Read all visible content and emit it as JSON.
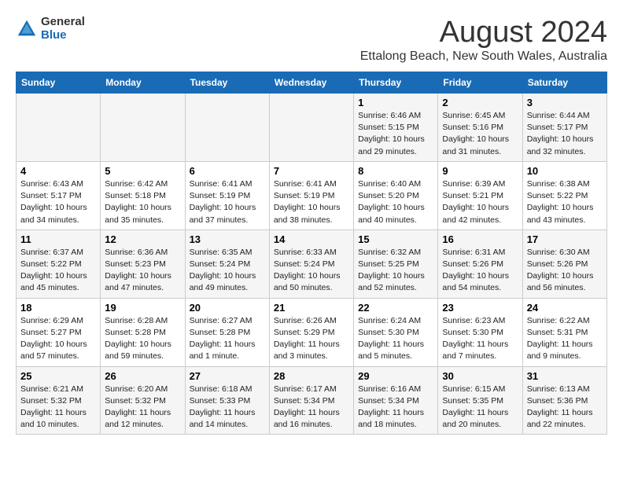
{
  "header": {
    "logo_general": "General",
    "logo_blue": "Blue",
    "month_title": "August 2024",
    "location": "Ettalong Beach, New South Wales, Australia"
  },
  "days_of_week": [
    "Sunday",
    "Monday",
    "Tuesday",
    "Wednesday",
    "Thursday",
    "Friday",
    "Saturday"
  ],
  "weeks": [
    [
      {
        "day": "",
        "info": ""
      },
      {
        "day": "",
        "info": ""
      },
      {
        "day": "",
        "info": ""
      },
      {
        "day": "",
        "info": ""
      },
      {
        "day": "1",
        "info": "Sunrise: 6:46 AM\nSunset: 5:15 PM\nDaylight: 10 hours\nand 29 minutes."
      },
      {
        "day": "2",
        "info": "Sunrise: 6:45 AM\nSunset: 5:16 PM\nDaylight: 10 hours\nand 31 minutes."
      },
      {
        "day": "3",
        "info": "Sunrise: 6:44 AM\nSunset: 5:17 PM\nDaylight: 10 hours\nand 32 minutes."
      }
    ],
    [
      {
        "day": "4",
        "info": "Sunrise: 6:43 AM\nSunset: 5:17 PM\nDaylight: 10 hours\nand 34 minutes."
      },
      {
        "day": "5",
        "info": "Sunrise: 6:42 AM\nSunset: 5:18 PM\nDaylight: 10 hours\nand 35 minutes."
      },
      {
        "day": "6",
        "info": "Sunrise: 6:41 AM\nSunset: 5:19 PM\nDaylight: 10 hours\nand 37 minutes."
      },
      {
        "day": "7",
        "info": "Sunrise: 6:41 AM\nSunset: 5:19 PM\nDaylight: 10 hours\nand 38 minutes."
      },
      {
        "day": "8",
        "info": "Sunrise: 6:40 AM\nSunset: 5:20 PM\nDaylight: 10 hours\nand 40 minutes."
      },
      {
        "day": "9",
        "info": "Sunrise: 6:39 AM\nSunset: 5:21 PM\nDaylight: 10 hours\nand 42 minutes."
      },
      {
        "day": "10",
        "info": "Sunrise: 6:38 AM\nSunset: 5:22 PM\nDaylight: 10 hours\nand 43 minutes."
      }
    ],
    [
      {
        "day": "11",
        "info": "Sunrise: 6:37 AM\nSunset: 5:22 PM\nDaylight: 10 hours\nand 45 minutes."
      },
      {
        "day": "12",
        "info": "Sunrise: 6:36 AM\nSunset: 5:23 PM\nDaylight: 10 hours\nand 47 minutes."
      },
      {
        "day": "13",
        "info": "Sunrise: 6:35 AM\nSunset: 5:24 PM\nDaylight: 10 hours\nand 49 minutes."
      },
      {
        "day": "14",
        "info": "Sunrise: 6:33 AM\nSunset: 5:24 PM\nDaylight: 10 hours\nand 50 minutes."
      },
      {
        "day": "15",
        "info": "Sunrise: 6:32 AM\nSunset: 5:25 PM\nDaylight: 10 hours\nand 52 minutes."
      },
      {
        "day": "16",
        "info": "Sunrise: 6:31 AM\nSunset: 5:26 PM\nDaylight: 10 hours\nand 54 minutes."
      },
      {
        "day": "17",
        "info": "Sunrise: 6:30 AM\nSunset: 5:26 PM\nDaylight: 10 hours\nand 56 minutes."
      }
    ],
    [
      {
        "day": "18",
        "info": "Sunrise: 6:29 AM\nSunset: 5:27 PM\nDaylight: 10 hours\nand 57 minutes."
      },
      {
        "day": "19",
        "info": "Sunrise: 6:28 AM\nSunset: 5:28 PM\nDaylight: 10 hours\nand 59 minutes."
      },
      {
        "day": "20",
        "info": "Sunrise: 6:27 AM\nSunset: 5:28 PM\nDaylight: 11 hours\nand 1 minute."
      },
      {
        "day": "21",
        "info": "Sunrise: 6:26 AM\nSunset: 5:29 PM\nDaylight: 11 hours\nand 3 minutes."
      },
      {
        "day": "22",
        "info": "Sunrise: 6:24 AM\nSunset: 5:30 PM\nDaylight: 11 hours\nand 5 minutes."
      },
      {
        "day": "23",
        "info": "Sunrise: 6:23 AM\nSunset: 5:30 PM\nDaylight: 11 hours\nand 7 minutes."
      },
      {
        "day": "24",
        "info": "Sunrise: 6:22 AM\nSunset: 5:31 PM\nDaylight: 11 hours\nand 9 minutes."
      }
    ],
    [
      {
        "day": "25",
        "info": "Sunrise: 6:21 AM\nSunset: 5:32 PM\nDaylight: 11 hours\nand 10 minutes."
      },
      {
        "day": "26",
        "info": "Sunrise: 6:20 AM\nSunset: 5:32 PM\nDaylight: 11 hours\nand 12 minutes."
      },
      {
        "day": "27",
        "info": "Sunrise: 6:18 AM\nSunset: 5:33 PM\nDaylight: 11 hours\nand 14 minutes."
      },
      {
        "day": "28",
        "info": "Sunrise: 6:17 AM\nSunset: 5:34 PM\nDaylight: 11 hours\nand 16 minutes."
      },
      {
        "day": "29",
        "info": "Sunrise: 6:16 AM\nSunset: 5:34 PM\nDaylight: 11 hours\nand 18 minutes."
      },
      {
        "day": "30",
        "info": "Sunrise: 6:15 AM\nSunset: 5:35 PM\nDaylight: 11 hours\nand 20 minutes."
      },
      {
        "day": "31",
        "info": "Sunrise: 6:13 AM\nSunset: 5:36 PM\nDaylight: 11 hours\nand 22 minutes."
      }
    ]
  ]
}
